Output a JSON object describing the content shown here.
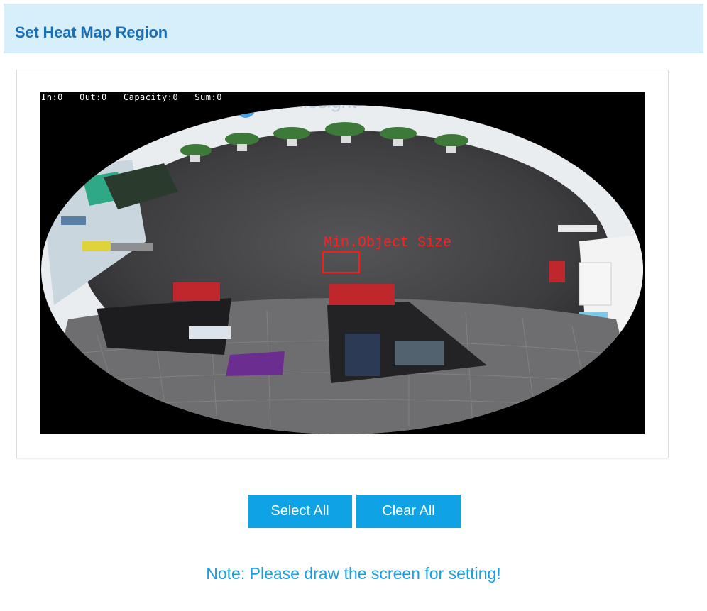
{
  "header": {
    "title": "Set Heat Map Region"
  },
  "video": {
    "osd_text": "In:0   Out:0   Capacity:0   Sum:0",
    "min_object_label": "Min.Object Size",
    "watermark": "Milesight"
  },
  "buttons": {
    "select_all": "Select All",
    "clear_all": "Clear All"
  },
  "note": "Note: Please draw the screen for setting!",
  "colors": {
    "header_bg": "#d7eefb",
    "header_text": "#1a6fb5",
    "button_bg": "#0fa3e6",
    "note_text": "#1aa0e0",
    "min_box": "#ff1a1a"
  }
}
